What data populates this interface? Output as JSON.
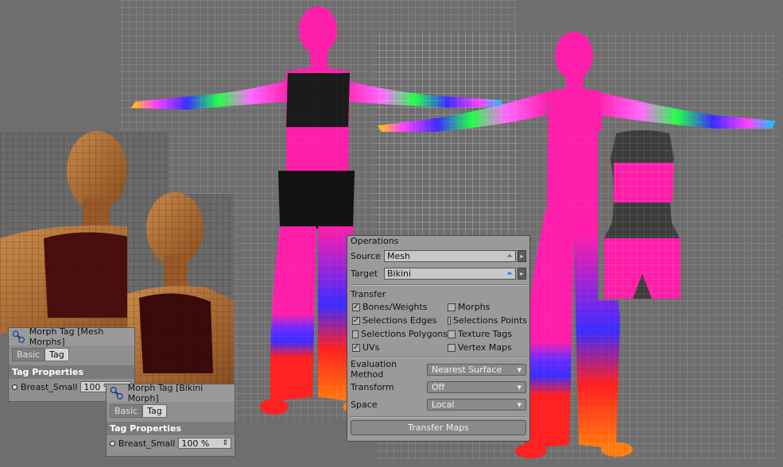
{
  "panel_left": {
    "title": "Morph Tag [Mesh Morphs]",
    "tabs": [
      {
        "label": "Basic",
        "active": false
      },
      {
        "label": "Tag",
        "active": true
      }
    ],
    "section": "Tag Properties",
    "prop_label": "Breast_Small",
    "prop_value": "100 %"
  },
  "panel_right": {
    "title": "Morph Tag [Bikini Morph]",
    "tabs": [
      {
        "label": "Basic",
        "active": false
      },
      {
        "label": "Tag",
        "active": true
      }
    ],
    "section": "Tag Properties",
    "prop_label": "Breast_Small",
    "prop_value": "100 %",
    "stepper_icon": "⇕"
  },
  "transfer_panel": {
    "operations_label": "Operations",
    "source_label": "Source",
    "source_value": "Mesh",
    "target_label": "Target",
    "target_value": "Bikini",
    "pick_icon": "⏶",
    "arrow_icon": "▸",
    "transfer_label": "Transfer",
    "options": [
      {
        "label": "Bones/Weights",
        "checked": true
      },
      {
        "label": "Morphs",
        "checked": false
      },
      {
        "label": "Selections Edges",
        "checked": true
      },
      {
        "label": "Selections Points",
        "checked": false
      },
      {
        "label": "Selections Polygons",
        "checked": false
      },
      {
        "label": "Texture Tags",
        "checked": false
      },
      {
        "label": "UVs",
        "checked": true
      },
      {
        "label": "Vertex Maps",
        "checked": false
      }
    ],
    "check_glyph": "✓",
    "evaluation_label": "Evaluation Method",
    "evaluation_value": "Nearest Surface",
    "transform_label": "Transform",
    "transform_value": "Off",
    "space_label": "Space",
    "space_value": "Local",
    "dropdown_icon": "▾",
    "button_label": "Transfer Maps"
  },
  "colors": {
    "panel_bg": "#9a9a9a",
    "viewport_bg": "#6e6e6e",
    "weight_pink": "#ff1ea8",
    "weight_green": "#22ff44",
    "weight_blue": "#3a2cff",
    "weight_red": "#ff2020",
    "weight_orange": "#ff7a10"
  }
}
